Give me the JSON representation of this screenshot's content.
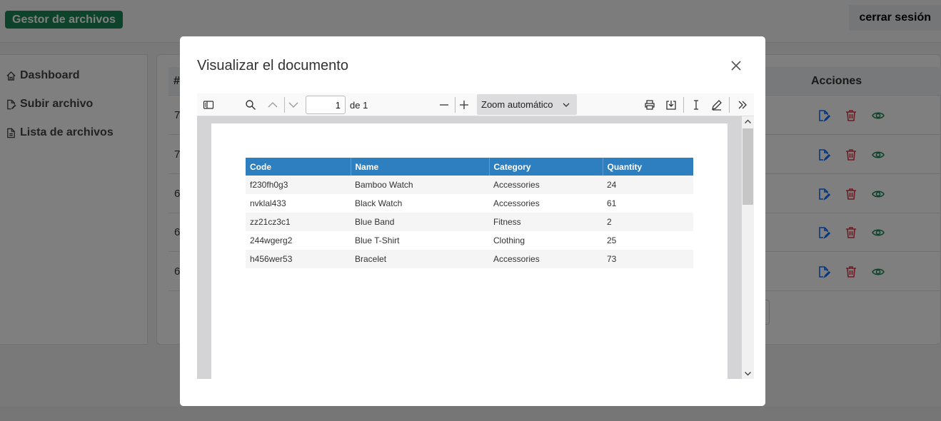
{
  "app": {
    "brand": "Gestor de archivos",
    "logout_label": "cerrar sesión"
  },
  "sidebar": {
    "items": [
      {
        "label": "Dashboard",
        "icon": "home-icon"
      },
      {
        "label": "Subir archivo",
        "icon": "file-edit-icon"
      },
      {
        "label": "Lista de archivos",
        "icon": "file-text-icon"
      }
    ]
  },
  "table": {
    "hash_header": "#",
    "actions_header": "Acciones",
    "rows": [
      {
        "id_fragment": "7"
      },
      {
        "id_fragment": "7"
      },
      {
        "id_fragment": "6"
      },
      {
        "id_fragment": "6"
      },
      {
        "id_fragment": "6"
      }
    ]
  },
  "colors": {
    "brand": "#198754",
    "edit": "#0d6efd",
    "delete": "#dc3545",
    "view": "#198754",
    "pdf_header": "#2e7fbf"
  },
  "modal": {
    "title": "Visualizar el documento",
    "viewer": {
      "page_number": "1",
      "page_count_label": "de 1",
      "zoom_label": "Zoom automático",
      "document": {
        "columns": [
          "Code",
          "Name",
          "Category",
          "Quantity"
        ],
        "rows": [
          [
            "f230fh0g3",
            "Bamboo Watch",
            "Accessories",
            "24"
          ],
          [
            "nvklal433",
            "Black Watch",
            "Accessories",
            "61"
          ],
          [
            "zz21cz3c1",
            "Blue Band",
            "Fitness",
            "2"
          ],
          [
            "244wgerg2",
            "Blue T-Shirt",
            "Clothing",
            "25"
          ],
          [
            "h456wer53",
            "Bracelet",
            "Accessories",
            "73"
          ]
        ]
      }
    }
  }
}
